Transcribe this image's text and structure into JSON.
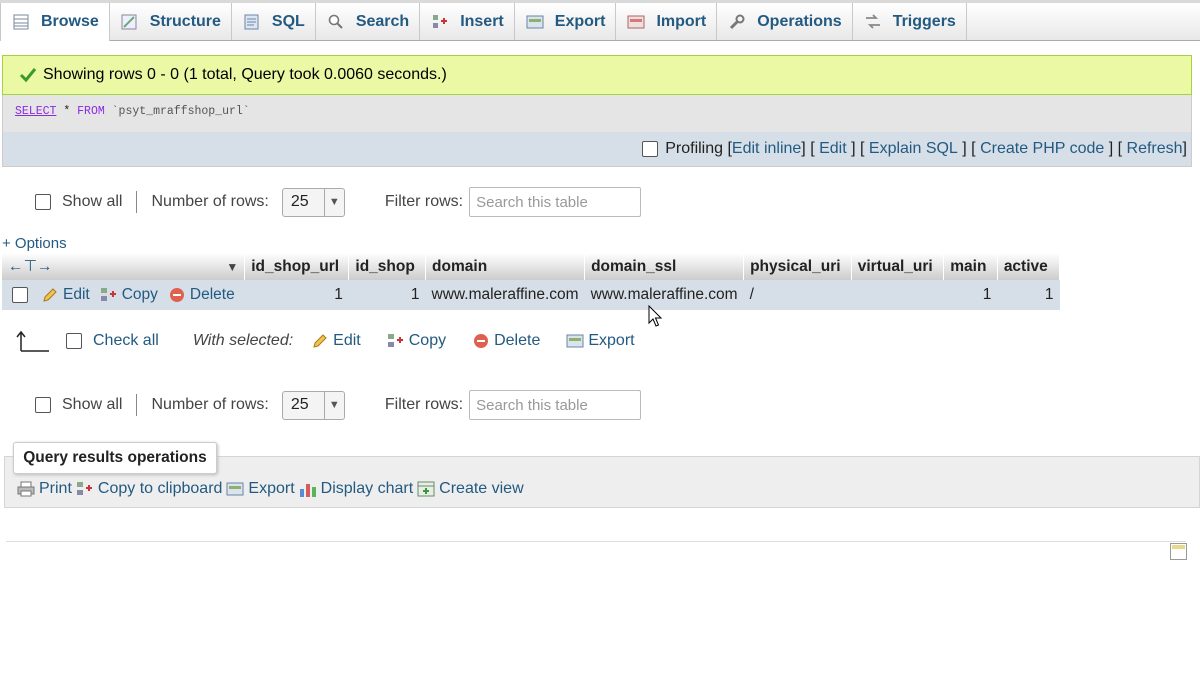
{
  "tabs": [
    {
      "label": "Browse",
      "icon": "browse-table-icon",
      "active": true
    },
    {
      "label": "Structure",
      "icon": "structure-icon"
    },
    {
      "label": "SQL",
      "icon": "sql-icon"
    },
    {
      "label": "Search",
      "icon": "search-icon"
    },
    {
      "label": "Insert",
      "icon": "insert-icon"
    },
    {
      "label": "Export",
      "icon": "export-icon"
    },
    {
      "label": "Import",
      "icon": "import-icon"
    },
    {
      "label": "Operations",
      "icon": "wrench-icon"
    },
    {
      "label": "Triggers",
      "icon": "triggers-icon"
    }
  ],
  "status": {
    "message": "Showing rows 0 - 0 (1 total, Query took 0.0060 seconds.)"
  },
  "query": {
    "select": "SELECT",
    "star": "*",
    "from": "FROM",
    "table": "`psyt_mraffshop_url`"
  },
  "profiling": {
    "label": "Profiling",
    "links": [
      "Edit inline",
      "Edit",
      "Explain SQL",
      "Create PHP code",
      "Refresh"
    ]
  },
  "nav": {
    "show_all": "Show all",
    "number_of_rows": "Number of rows:",
    "rows_value": "25",
    "filter_rows": "Filter rows:",
    "search_placeholder": "Search this table"
  },
  "options_link": "+ Options",
  "table": {
    "columns": [
      "id_shop_url",
      "id_shop",
      "domain",
      "domain_ssl",
      "physical_uri",
      "virtual_uri",
      "main",
      "active"
    ],
    "row_actions": {
      "edit": "Edit",
      "copy": "Copy",
      "delete": "Delete"
    },
    "rows": [
      {
        "id_shop_url": "1",
        "id_shop": "1",
        "domain": "www.maleraffine.com",
        "domain_ssl": "www.maleraffine.com",
        "physical_uri": "/",
        "virtual_uri": "",
        "main": "1",
        "active": "1"
      }
    ]
  },
  "with_selected": {
    "check_all": "Check all",
    "label": "With selected:",
    "edit": "Edit",
    "copy": "Copy",
    "delete": "Delete",
    "export": "Export"
  },
  "query_results_operations": {
    "title": "Query results operations",
    "print": "Print",
    "copy_to_clipboard": "Copy to clipboard",
    "export": "Export",
    "display_chart": "Display chart",
    "create_view": "Create view"
  }
}
